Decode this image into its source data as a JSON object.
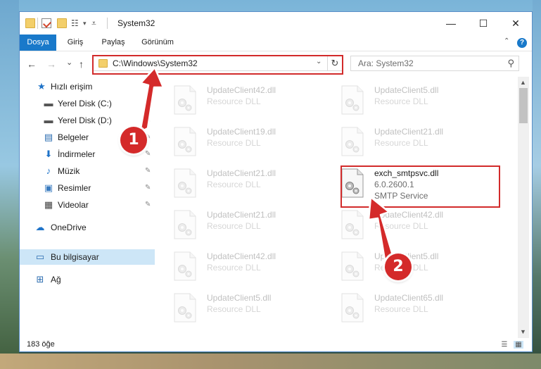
{
  "window": {
    "title": "System32",
    "minimize_glyph": "—",
    "maximize_glyph": "☐",
    "close_glyph": "✕"
  },
  "ribbon": {
    "tabs": [
      {
        "label": "Dosya",
        "active": true
      },
      {
        "label": "Giriş",
        "active": false
      },
      {
        "label": "Paylaş",
        "active": false
      },
      {
        "label": "Görünüm",
        "active": false
      }
    ],
    "help_glyph": "?",
    "collapse_glyph": "⌃"
  },
  "address": {
    "path": "C:\\Windows\\System32",
    "back_glyph": "←",
    "forward_glyph": "→",
    "recent_glyph": "⌄",
    "up_glyph": "↑",
    "dropdown_glyph": "⌄",
    "refresh_glyph": "↻"
  },
  "search": {
    "placeholder": "Ara: System32",
    "icon": "search-icon",
    "icon_glyph": "⚲"
  },
  "nav": {
    "items": [
      {
        "label": "Hızlı erişim",
        "icon": "star-icon",
        "glyph": "★",
        "color": "#1f73c8",
        "pinned": false
      },
      {
        "label": "Yerel Disk (C:)",
        "icon": "drive-icon",
        "glyph": "▬",
        "color": "#555555",
        "pinned": true
      },
      {
        "label": "Yerel Disk (D:)",
        "icon": "drive-icon",
        "glyph": "▬",
        "color": "#555555",
        "pinned": true
      },
      {
        "label": "Belgeler",
        "icon": "document-icon",
        "glyph": "▤",
        "color": "#2b6cb0",
        "pinned": true
      },
      {
        "label": "İndirmeler",
        "icon": "download-icon",
        "glyph": "⬇",
        "color": "#1f73c8",
        "pinned": true
      },
      {
        "label": "Müzik",
        "icon": "music-icon",
        "glyph": "♪",
        "color": "#1f73c8",
        "pinned": true
      },
      {
        "label": "Resimler",
        "icon": "picture-icon",
        "glyph": "▣",
        "color": "#3a7bbf",
        "pinned": true
      },
      {
        "label": "Videolar",
        "icon": "video-icon",
        "glyph": "▦",
        "color": "#444444",
        "pinned": true
      },
      {
        "label": "OneDrive",
        "icon": "cloud-icon",
        "glyph": "☁",
        "color": "#1f73c8",
        "pinned": false
      },
      {
        "label": "Bu bilgisayar",
        "icon": "computer-icon",
        "glyph": "▭",
        "color": "#2b6cb0",
        "pinned": false,
        "selected": true
      },
      {
        "label": "Ağ",
        "icon": "network-icon",
        "glyph": "⊞",
        "color": "#2b6cb0",
        "pinned": false
      }
    ],
    "pin_glyph": "✎"
  },
  "files": [
    {
      "name": "UpdateClient42.dll",
      "sub": "Resource DLL",
      "faded": true
    },
    {
      "name": "UpdateClient5.dll",
      "sub": "Resource DLL",
      "faded": true
    },
    {
      "name": "UpdateClient19.dll",
      "sub": "Resource DLL",
      "faded": true
    },
    {
      "name": "UpdateClient21.dll",
      "sub": "Resource DLL",
      "faded": true
    },
    {
      "name": "UpdateClient21.dll",
      "sub": "Resource DLL",
      "faded": true
    },
    {
      "name": "exch_smtpsvc.dll",
      "sub": "6.0.2600.1",
      "sub2": "SMTP Service",
      "faded": false
    },
    {
      "name": "UpdateClient21.dll",
      "sub": "Resource DLL",
      "faded": true
    },
    {
      "name": "UpdateClient42.dll",
      "sub": "Resource DLL",
      "faded": true
    },
    {
      "name": "UpdateClient42.dll",
      "sub": "Resource DLL",
      "faded": true
    },
    {
      "name": "UpdateClient5.dll",
      "sub": "Resource DLL",
      "faded": true
    },
    {
      "name": "UpdateClient5.dll",
      "sub": "Resource DLL",
      "faded": true
    },
    {
      "name": "UpdateClient65.dll",
      "sub": "Resource DLL",
      "faded": true
    }
  ],
  "status": {
    "item_count": "183 öğe",
    "details_view_glyph": "☰",
    "tiles_view_glyph": "▦"
  },
  "scroll": {
    "up_glyph": "▲",
    "down_glyph": "▼"
  },
  "annotations": {
    "step1": "1",
    "step2": "2",
    "highlight_color": "#d22b2b"
  }
}
